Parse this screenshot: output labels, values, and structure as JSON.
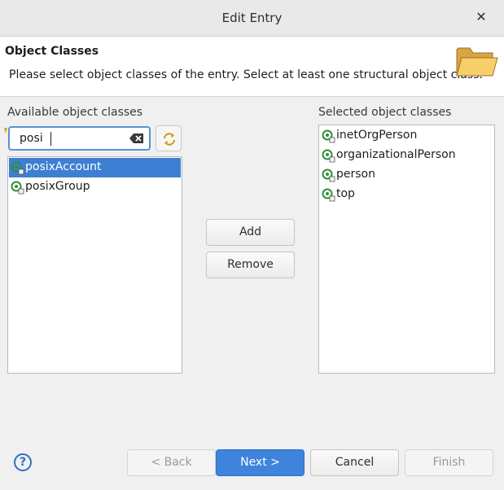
{
  "window": {
    "title": "Edit Entry",
    "close_glyph": "✕"
  },
  "header": {
    "title": "Object Classes",
    "description": "Please select object classes of the entry. Select at least one structural object class.",
    "icon": "folder-icon"
  },
  "available": {
    "label": "Available object classes",
    "search_value": "posi",
    "items": [
      {
        "label": "posixAccount",
        "selected": true,
        "icon": "object-class-icon"
      },
      {
        "label": "posixGroup",
        "selected": false,
        "icon": "object-class-icon"
      }
    ]
  },
  "selected": {
    "label": "Selected object classes",
    "items": [
      {
        "label": "inetOrgPerson",
        "icon": "object-class-icon"
      },
      {
        "label": "organizationalPerson",
        "icon": "object-class-icon"
      },
      {
        "label": "person",
        "icon": "object-class-icon"
      },
      {
        "label": "top",
        "icon": "object-class-icon"
      }
    ]
  },
  "actions": {
    "add": "Add",
    "remove": "Remove"
  },
  "footer": {
    "help": "?",
    "back": "< Back",
    "next": "Next >",
    "cancel": "Cancel",
    "finish": "Finish"
  },
  "colors": {
    "accent": "#3e84dc",
    "selection": "#3d7fd3",
    "icon_green": "#2f8f3a"
  }
}
